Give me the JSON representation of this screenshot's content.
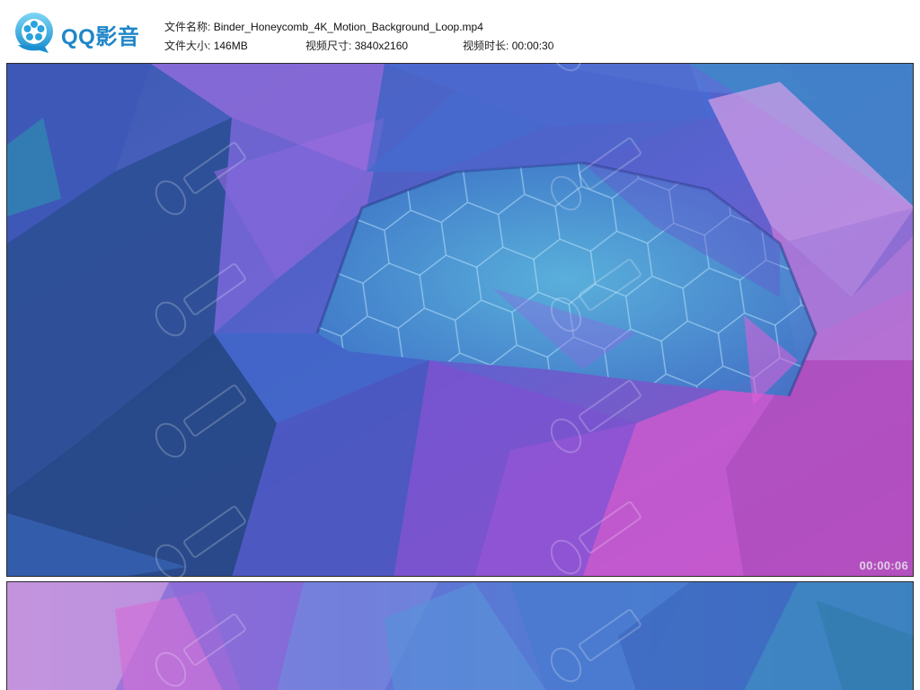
{
  "app": {
    "logo_text": "QQ影音",
    "brand_color": "#1f86c8"
  },
  "file_info": {
    "name_label": "文件名称:",
    "name_value": "Binder_Honeycomb_4K_Motion_Background_Loop.mp4",
    "size_label": "文件大小:",
    "size_value": "146MB",
    "resolution_label": "视频尺寸:",
    "resolution_value": "3840x2160",
    "duration_label": "视频时长:",
    "duration_value": "00:00:30"
  },
  "frames": [
    {
      "timestamp": "00:00:06"
    },
    {
      "timestamp": ""
    }
  ],
  "watermark": {
    "icon": "watermark-logo-icon"
  },
  "colors": {
    "deep_blue": "#2c4f93",
    "mid_blue": "#4a6fd0",
    "teal": "#3fa8c8",
    "violet": "#8a5bd6",
    "magenta": "#c85bd0",
    "pink": "#d070d8"
  }
}
